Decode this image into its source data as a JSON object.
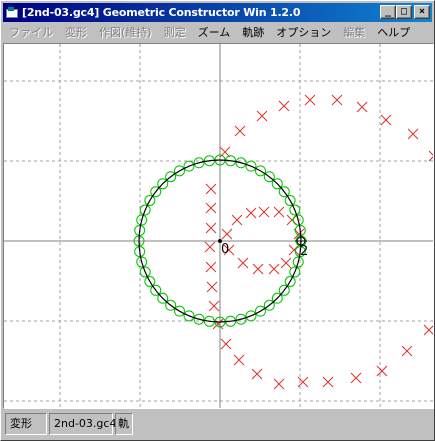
{
  "window": {
    "title": "[2nd-03.gc4] Geometric Constructor Win 1.2.0",
    "buttons": {
      "minimize": "_",
      "maximize": "□",
      "close": "×"
    }
  },
  "menu": {
    "items": [
      {
        "label": "ファイル",
        "enabled": false
      },
      {
        "label": "変形",
        "enabled": false
      },
      {
        "label": "作図(維持)",
        "enabled": false
      },
      {
        "label": "測定",
        "enabled": false
      },
      {
        "label": "ズーム",
        "enabled": true
      },
      {
        "label": "軌跡",
        "enabled": true
      },
      {
        "label": "オプション",
        "enabled": true
      },
      {
        "label": "編集",
        "enabled": false
      },
      {
        "label": "ヘルプ",
        "enabled": true
      }
    ]
  },
  "canvas": {
    "point_labels": {
      "origin": "0",
      "point2": "2"
    },
    "colors": {
      "grid": "#a0a0a0",
      "axis": "#808080",
      "circle": "#000000",
      "locus_circle": "#00c000",
      "locus_cross": "#e03030"
    }
  },
  "status": {
    "mode": "変形",
    "file": "2nd-03.gc4",
    "extra": "軌"
  }
}
